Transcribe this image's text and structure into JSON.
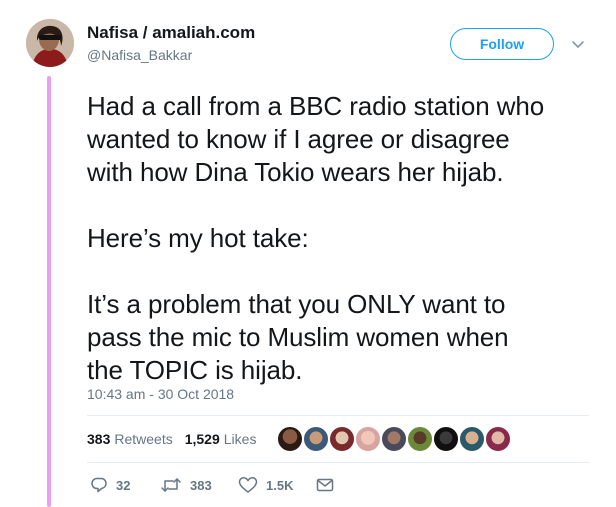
{
  "author": {
    "display_name": "Nafisa / amaliah.com",
    "handle": "@Nafisa_Bakkar"
  },
  "follow_label": "Follow",
  "tweet": {
    "lines_para1": [
      "Had a call from a BBC radio station who",
      "wanted to know if I agree or disagree",
      "with how Dina Tokio wears her hijab."
    ],
    "para2": "Here’s my hot take:",
    "lines_para3": [
      "It’s a problem that you ONLY want to",
      "pass the mic to Muslim women when",
      "the TOPIC is hijab."
    ],
    "timestamp": "10:43 am - 30 Oct 2018"
  },
  "stats": {
    "retweets_count": "383",
    "retweets_label": "Retweets",
    "likes_count": "1,529",
    "likes_label": "Likes"
  },
  "actions": {
    "reply_count": "32",
    "retweet_count": "383",
    "like_count": "1.5K"
  },
  "icons": {
    "caret": "chevron-down-icon",
    "reply": "reply-icon",
    "retweet": "retweet-icon",
    "like": "heart-icon",
    "dm": "envelope-icon"
  },
  "colors": {
    "accent": "#1da1f2",
    "thread_line": "#e7a0f4",
    "secondary_text": "#657786",
    "primary_text": "#14171a"
  }
}
